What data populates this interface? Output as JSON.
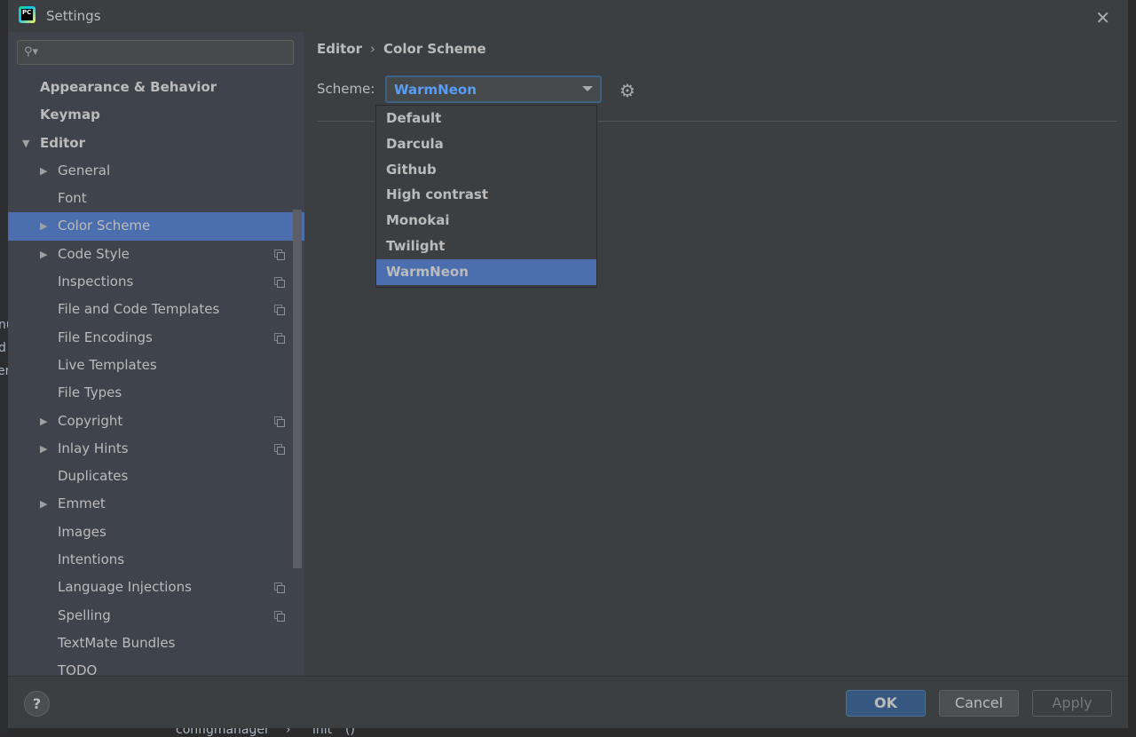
{
  "window": {
    "title": "Settings",
    "app_icon": "pycharm-logo",
    "close_icon": "close-icon"
  },
  "search": {
    "placeholder": "",
    "value": ""
  },
  "sidebar": {
    "items": [
      {
        "label": "Appearance & Behavior",
        "level": 0,
        "bold": true,
        "arrow": "",
        "copy": false
      },
      {
        "label": "Keymap",
        "level": 0,
        "bold": true,
        "arrow": "",
        "copy": false
      },
      {
        "label": "Editor",
        "level": 0,
        "bold": true,
        "arrow": "expanded",
        "copy": false
      },
      {
        "label": "General",
        "level": 1,
        "arrow": "collapsed",
        "copy": false
      },
      {
        "label": "Font",
        "level": 1,
        "arrow": "",
        "copy": false
      },
      {
        "label": "Color Scheme",
        "level": 1,
        "arrow": "collapsed",
        "copy": false,
        "selected": true
      },
      {
        "label": "Code Style",
        "level": 1,
        "arrow": "collapsed",
        "copy": true
      },
      {
        "label": "Inspections",
        "level": 1,
        "arrow": "",
        "copy": true
      },
      {
        "label": "File and Code Templates",
        "level": 1,
        "arrow": "",
        "copy": true
      },
      {
        "label": "File Encodings",
        "level": 1,
        "arrow": "",
        "copy": true
      },
      {
        "label": "Live Templates",
        "level": 1,
        "arrow": "",
        "copy": false
      },
      {
        "label": "File Types",
        "level": 1,
        "arrow": "",
        "copy": false
      },
      {
        "label": "Copyright",
        "level": 1,
        "arrow": "collapsed",
        "copy": true
      },
      {
        "label": "Inlay Hints",
        "level": 1,
        "arrow": "collapsed",
        "copy": true
      },
      {
        "label": "Duplicates",
        "level": 1,
        "arrow": "",
        "copy": false
      },
      {
        "label": "Emmet",
        "level": 1,
        "arrow": "collapsed",
        "copy": false
      },
      {
        "label": "Images",
        "level": 1,
        "arrow": "",
        "copy": false
      },
      {
        "label": "Intentions",
        "level": 1,
        "arrow": "",
        "copy": false
      },
      {
        "label": "Language Injections",
        "level": 1,
        "arrow": "",
        "copy": true
      },
      {
        "label": "Spelling",
        "level": 1,
        "arrow": "",
        "copy": true
      },
      {
        "label": "TextMate Bundles",
        "level": 1,
        "arrow": "",
        "copy": false
      },
      {
        "label": "TODO",
        "level": 1,
        "arrow": "",
        "copy": false
      }
    ]
  },
  "main": {
    "breadcrumb": [
      "Editor",
      "Color Scheme"
    ],
    "breadcrumb_sep": "›",
    "scheme_label": "Scheme:",
    "scheme_value": "WarmNeon",
    "scheme_options": [
      "Default",
      "Darcula",
      "Github",
      "High contrast",
      "Monokai",
      "Twilight",
      "WarmNeon"
    ],
    "selected_option": "WarmNeon"
  },
  "footer": {
    "help": "?",
    "ok": "OK",
    "cancel": "Cancel",
    "apply": "Apply"
  },
  "background": {
    "fragments": [
      "nu",
      "d",
      "er"
    ],
    "status": [
      "configmanager",
      "›",
      "init",
      "()"
    ]
  },
  "colors": {
    "accent": "#4b6eaf",
    "combo_text": "#589df6",
    "ok_button": "#365880"
  }
}
